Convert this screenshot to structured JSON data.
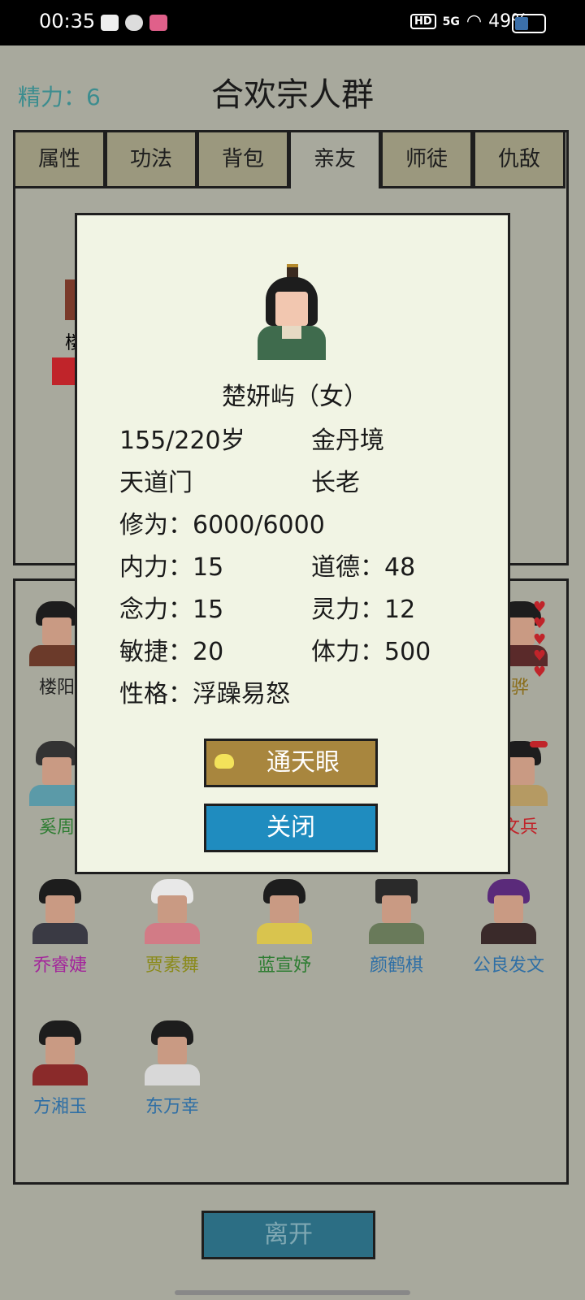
{
  "status_bar": {
    "time": "00:35",
    "network_badge": "HD",
    "signal": "5G",
    "battery_percent": "49%",
    "battery_level": 0.49
  },
  "header": {
    "energy": "精力：6",
    "title": "合欢宗人群"
  },
  "tabs": [
    {
      "label": "属性"
    },
    {
      "label": "功法"
    },
    {
      "label": "背包"
    },
    {
      "label": "亲友"
    },
    {
      "label": "师徒"
    },
    {
      "label": "仇敌"
    }
  ],
  "active_tab": "亲友",
  "top_panel_partial": {
    "name_fragment": "楼"
  },
  "characters": [
    {
      "name": "楼阳",
      "color": "#222222",
      "outfit": "#6b3a2a"
    },
    {
      "name": "骅",
      "color": "#8a6d1a",
      "outfit": "#5a2a2a"
    },
    {
      "name": "奚周",
      "color": "#2e7d32",
      "outfit": "#5b9aa8"
    },
    {
      "name": "文兵",
      "color": "#c0242a",
      "outfit": "#b59a63"
    },
    {
      "name": "乔睿婕",
      "color": "#a3269b",
      "outfit": "#3a3a44"
    },
    {
      "name": "贾素舞",
      "color": "#8a8a1a",
      "outfit": "#d27b86"
    },
    {
      "name": "蓝宣妤",
      "color": "#2e7d32",
      "outfit": "#d9c44e"
    },
    {
      "name": "颜鹤棋",
      "color": "#2f6fa5",
      "outfit": "#697a5a"
    },
    {
      "name": "公良发文",
      "color": "#2f6fa5",
      "outfit": "#3a2a2a"
    },
    {
      "name": "方湘玉",
      "color": "#2f6fa5",
      "outfit": "#8a2a2a"
    },
    {
      "name": "东万幸",
      "color": "#2f6fa5",
      "outfit": "#d8d8d8"
    }
  ],
  "hearts": [
    "♥",
    "♥",
    "♥",
    "♥",
    "♥"
  ],
  "modal": {
    "name": "楚妍屿（女）",
    "age": "155/220岁",
    "realm": "金丹境",
    "sect": "天道门",
    "rank": "长老",
    "cultivation": "修为：6000/6000",
    "inner_power": "内力：15",
    "morality": "道德：48",
    "mind_power": "念力：15",
    "spirit_power": "灵力：12",
    "agility": "敏捷：20",
    "stamina": "体力：500",
    "personality": "性格：浮躁易怒",
    "sky_eye_button": "通天眼",
    "close_button": "关闭"
  },
  "footer": {
    "leave_button": "离开"
  }
}
